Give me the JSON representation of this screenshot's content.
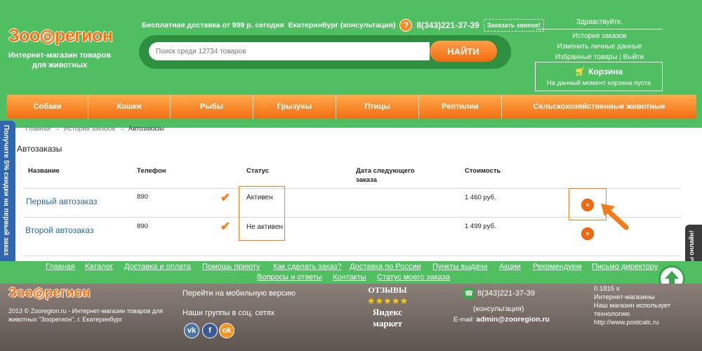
{
  "header": {
    "logo_text": "Зоо◎регион",
    "tagline": "Интернет-магазин товаров для животных",
    "delivery_text": "Бесплатная доставка от 999 р. сегодня",
    "city_text": "Екатеринбург (консультация)",
    "help_icon": "?",
    "phone": "8(343)221-37-39",
    "callback_label": "Заказать звонок!",
    "search": {
      "placeholder": "Поиск среди 12734 товаров",
      "button_label": "НАЙТИ"
    },
    "account": {
      "greeting": "Здравствуйте,",
      "links": [
        "История заказов",
        "Изменить личные данные"
      ],
      "favorites": "Избранные товары",
      "logout": "Выйти",
      "divider": "|"
    },
    "cart": {
      "title": "Корзина",
      "status": "На данный момент корзина пуста"
    }
  },
  "nav": [
    "Собаки",
    "Кошки",
    "Рыбы",
    "Грызуны",
    "Птицы",
    "Рептилии",
    "Сельскохозяйственные животные"
  ],
  "promo_text": "Получите 5% скидки на первый заказ",
  "breadcrumb": {
    "home": "Главная",
    "history": "История заказов",
    "current": "Автозаказы",
    "sep": "→"
  },
  "page_title": "Автозаказы",
  "table": {
    "headers": {
      "name": "Название",
      "phone": "Телефон",
      "status": "Статус",
      "next_date": "Дата следующего заказа",
      "cost": "Стоимость"
    },
    "rows": [
      {
        "name": "Первый автозаказ",
        "phone": "890",
        "status": "Активен",
        "cost": "1 460 руб.",
        "delete": "×"
      },
      {
        "name": "Второй автозаказ",
        "phone": "890",
        "status": "Не активен",
        "cost": "1 499 руб.",
        "delete": "×"
      }
    ]
  },
  "chat_text": "Напишите нам, мы онлайн!",
  "footer_links": [
    "Главная",
    "Каталог",
    "Доставка и оплата",
    "Помощь приюту",
    "Как сделать заказ?",
    "Доставка по России",
    "Пункты выдачи",
    "Акции",
    "Рекомендуем",
    "Письмо директору",
    "Вопросы и ответы",
    "Контакты",
    "Статус моего заказа"
  ],
  "footer": {
    "logo_text": "Зоо◎регион",
    "copyright": "2013 © Zooregion.ru - Интернет-магазин товаров для животных \"Зоорегион\", г. Екатеринбург",
    "mobile_link": "Перейти на мобильную версию",
    "groups_label": "Наши группы в соц. сетях",
    "social": [
      "vk",
      "f",
      "ok"
    ],
    "reviews_title": "ОТЗЫВЫ",
    "stars": "★★★★★",
    "yandex_line1": "Яндекс",
    "yandex_line2": "маркет",
    "phone": "8(343)221-37-39",
    "consult": "(консультация)",
    "email_label": "E-mail:",
    "email": "admin@zooregion.ru",
    "calc_value": "0.1815 s",
    "calc_line1": "Интернет-магазины",
    "calc_line2": "Наш магазин использует",
    "calc_line3": "технологию",
    "calc_link": "http://www.postcalc.ru"
  }
}
